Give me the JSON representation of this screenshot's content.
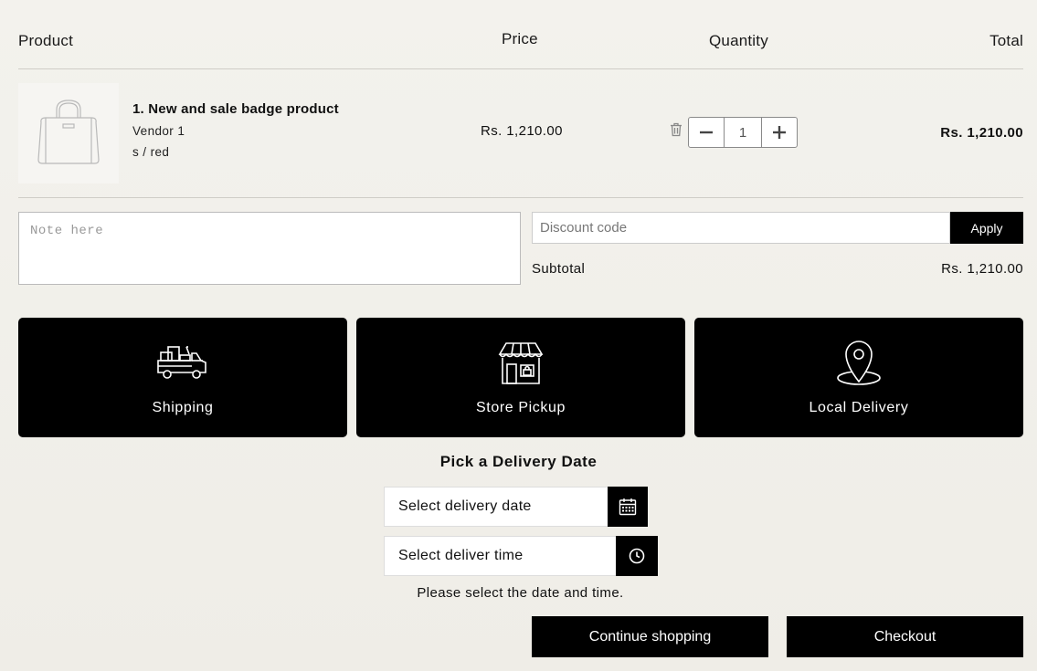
{
  "header": {
    "product": "Product",
    "price": "Price",
    "quantity": "Quantity",
    "total": "Total"
  },
  "cart_item": {
    "icon": "handbag-icon",
    "name": "1. New and sale badge product",
    "vendor": "Vendor 1",
    "variant": "s / red",
    "price": "Rs. 1,210.00",
    "quantity": "1",
    "total": "Rs. 1,210.00"
  },
  "note": {
    "placeholder": "Note here"
  },
  "discount": {
    "placeholder": "Discount code",
    "apply_label": "Apply"
  },
  "subtotal": {
    "label": "Subtotal",
    "value": "Rs. 1,210.00"
  },
  "delivery_options": [
    {
      "label": "Shipping",
      "icon": "truck-icon"
    },
    {
      "label": "Store Pickup",
      "icon": "store-icon"
    },
    {
      "label": "Local Delivery",
      "icon": "map-pin-icon"
    }
  ],
  "delivery": {
    "title": "Pick a Delivery Date",
    "date_placeholder": "Select delivery date",
    "time_placeholder": "Select deliver time",
    "hint": "Please select the date and time."
  },
  "actions": {
    "continue_label": "Continue shopping",
    "checkout_label": "Checkout"
  },
  "colors": {
    "accent": "#000000",
    "background": "#f1f0eb"
  }
}
